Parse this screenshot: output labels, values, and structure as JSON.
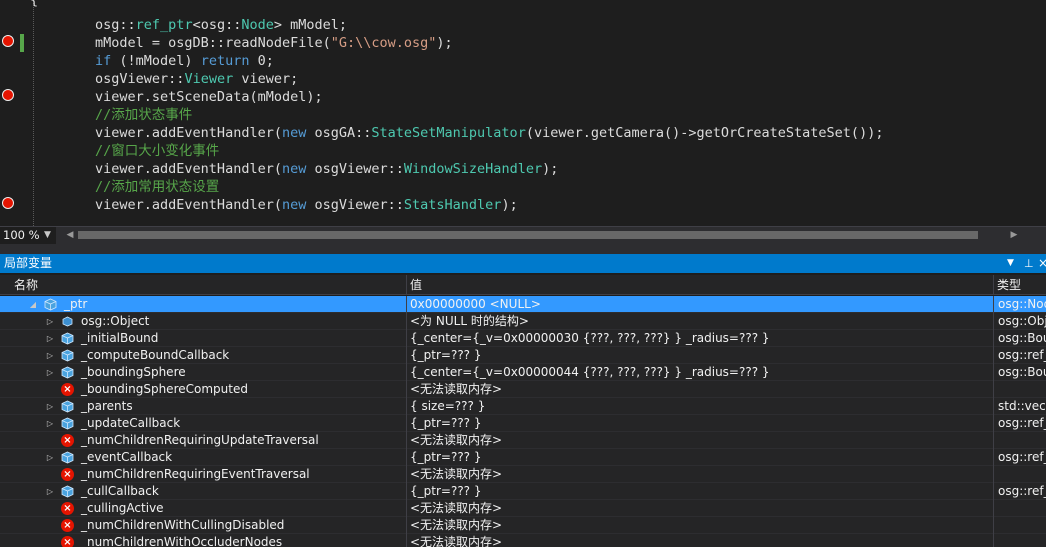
{
  "editor": {
    "lines": [
      {
        "tokens": [
          {
            "c": "pl",
            "t": "{"
          }
        ]
      },
      {
        "tokens": [
          {
            "c": "pl",
            "t": "        osg::"
          },
          {
            "c": "ty",
            "t": "ref_ptr"
          },
          {
            "c": "pl",
            "t": "<osg::"
          },
          {
            "c": "ty",
            "t": "Node"
          },
          {
            "c": "pl",
            "t": "> mModel;"
          }
        ]
      },
      {
        "tokens": [
          {
            "c": "pl",
            "t": "        mModel = osgDB::readNodeFile("
          },
          {
            "c": "st",
            "t": "\"G:\\\\cow.osg\""
          },
          {
            "c": "pl",
            "t": ");"
          }
        ]
      },
      {
        "tokens": [
          {
            "c": "kw",
            "t": "        if"
          },
          {
            "c": "pl",
            "t": " (!mModel) "
          },
          {
            "c": "kw",
            "t": "return"
          },
          {
            "c": "pl",
            "t": " 0;"
          }
        ]
      },
      {
        "tokens": [
          {
            "c": "pl",
            "t": "        osgViewer::"
          },
          {
            "c": "ty",
            "t": "Viewer"
          },
          {
            "c": "pl",
            "t": " viewer;"
          }
        ]
      },
      {
        "tokens": [
          {
            "c": "pl",
            "t": "        viewer.setSceneData(mModel);"
          }
        ]
      },
      {
        "tokens": [
          {
            "c": "cm",
            "t": "        //添加状态事件"
          }
        ]
      },
      {
        "tokens": [
          {
            "c": "pl",
            "t": "        viewer.addEventHandler("
          },
          {
            "c": "kw",
            "t": "new"
          },
          {
            "c": "pl",
            "t": " osgGA::"
          },
          {
            "c": "ty",
            "t": "StateSetManipulator"
          },
          {
            "c": "pl",
            "t": "(viewer.getCamera()->getOrCreateStateSet());"
          }
        ]
      },
      {
        "tokens": [
          {
            "c": "cm",
            "t": "        //窗口大小变化事件"
          }
        ]
      },
      {
        "tokens": [
          {
            "c": "pl",
            "t": "        viewer.addEventHandler("
          },
          {
            "c": "kw",
            "t": "new"
          },
          {
            "c": "pl",
            "t": " osgViewer::"
          },
          {
            "c": "ty",
            "t": "WindowSizeHandler"
          },
          {
            "c": "pl",
            "t": ");"
          }
        ]
      },
      {
        "tokens": [
          {
            "c": "cm",
            "t": "        //添加常用状态设置"
          }
        ]
      },
      {
        "tokens": [
          {
            "c": "pl",
            "t": "        viewer.addEventHandler("
          },
          {
            "c": "kw",
            "t": "new"
          },
          {
            "c": "pl",
            "t": " osgViewer::"
          },
          {
            "c": "ty",
            "t": "StatsHandler"
          },
          {
            "c": "pl",
            "t": ");"
          }
        ]
      }
    ]
  },
  "zoom": {
    "label": "100 %"
  },
  "locals": {
    "title": "局部变量",
    "columns": {
      "name": "名称",
      "value": "值",
      "type": "类型"
    },
    "rows": [
      {
        "depth": 0,
        "expand": "open",
        "icon": "object",
        "name": "_ptr",
        "value": "0x00000000 <NULL>",
        "type": "osg::Node",
        "selected": true
      },
      {
        "depth": 1,
        "expand": "closed",
        "icon": "base",
        "name": "osg::Object",
        "value": "<为 NULL 时的结构>",
        "type": "osg::Object"
      },
      {
        "depth": 1,
        "expand": "closed",
        "icon": "object",
        "name": "_initialBound",
        "value": "{_center={_v=0x00000030 {???, ???, ???} } _radius=??? }",
        "type": "osg::BoundingSphere"
      },
      {
        "depth": 1,
        "expand": "closed",
        "icon": "object",
        "name": "_computeBoundCallback",
        "value": "{_ptr=??? }",
        "type": "osg::ref_ptr"
      },
      {
        "depth": 1,
        "expand": "closed",
        "icon": "object",
        "name": "_boundingSphere",
        "value": "{_center={_v=0x00000044 {???, ???, ???} } _radius=??? }",
        "type": "osg::BoundingSphere"
      },
      {
        "depth": 1,
        "expand": "none",
        "icon": "error",
        "name": "_boundingSphereComputed",
        "value": "<无法读取内存>",
        "type": ""
      },
      {
        "depth": 1,
        "expand": "closed",
        "icon": "object",
        "name": "_parents",
        "value": "{ size=??? }",
        "type": "std::vector"
      },
      {
        "depth": 1,
        "expand": "closed",
        "icon": "object",
        "name": "_updateCallback",
        "value": "{_ptr=??? }",
        "type": "osg::ref_ptr"
      },
      {
        "depth": 1,
        "expand": "none",
        "icon": "error",
        "name": "_numChildrenRequiringUpdateTraversal",
        "value": "<无法读取内存>",
        "type": ""
      },
      {
        "depth": 1,
        "expand": "closed",
        "icon": "object",
        "name": "_eventCallback",
        "value": "{_ptr=??? }",
        "type": "osg::ref_ptr"
      },
      {
        "depth": 1,
        "expand": "none",
        "icon": "error",
        "name": "_numChildrenRequiringEventTraversal",
        "value": "<无法读取内存>",
        "type": ""
      },
      {
        "depth": 1,
        "expand": "closed",
        "icon": "object",
        "name": "_cullCallback",
        "value": "{_ptr=??? }",
        "type": "osg::ref_ptr"
      },
      {
        "depth": 1,
        "expand": "none",
        "icon": "error",
        "name": "_cullingActive",
        "value": "<无法读取内存>",
        "type": ""
      },
      {
        "depth": 1,
        "expand": "none",
        "icon": "error",
        "name": "_numChildrenWithCullingDisabled",
        "value": "<无法读取内存>",
        "type": ""
      },
      {
        "depth": 1,
        "expand": "none",
        "icon": "error",
        "name": "_numChildrenWithOccluderNodes",
        "value": "<无法读取内存>",
        "type": ""
      }
    ]
  },
  "colors": {
    "accent": "#007acc",
    "selection": "#3399ff",
    "breakpoint": "#e51400",
    "comment": "#57a64a",
    "keyword": "#569cd6",
    "type": "#4ec9b0",
    "string": "#d69d85"
  }
}
